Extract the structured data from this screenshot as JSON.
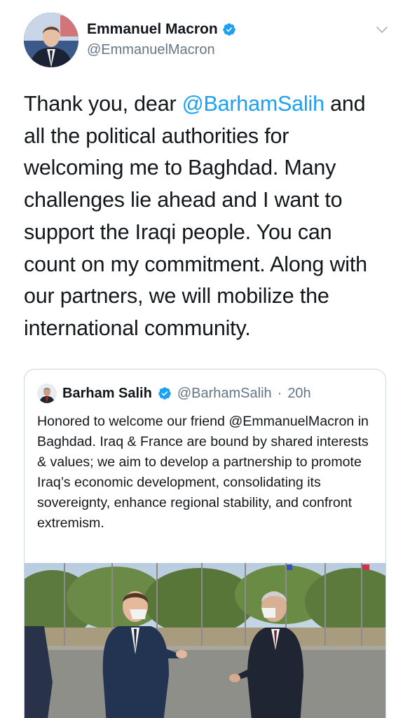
{
  "tweet": {
    "author": {
      "name": "Emmanuel Macron",
      "handle": "@EmmanuelMacron",
      "verified": true,
      "avatar_icon": "profile-photo"
    },
    "menu_icon": "chevron-down-icon",
    "text_parts": [
      "Thank you, dear ",
      "@BarhamSalih",
      " and all the political authorities for welcoming me to Baghdad. Many challenges lie ahead and I want to support the Iraqi people. You can count on my commitment. Along with our partners, we will mobilize the international community."
    ]
  },
  "quoted_tweet": {
    "author": {
      "name": "Barham Salih",
      "handle": "@BarhamSalih",
      "separator": "·",
      "time": "20h",
      "verified": true
    },
    "text": "Honored to welcome our friend @EmmanuelMacron in Baghdad. Iraq & France are bound by shared interests & values; we aim to develop a partnership to promote Iraq’s economic development, consolidating its sovereignty, enhance regional stability, and confront extremism.",
    "media_icon": "photo-two-men-greeting"
  },
  "colors": {
    "link": "#1da1f2",
    "text": "#14171a",
    "secondary": "#657786",
    "verified": "#1da1f2",
    "border": "#ccd6dd"
  }
}
